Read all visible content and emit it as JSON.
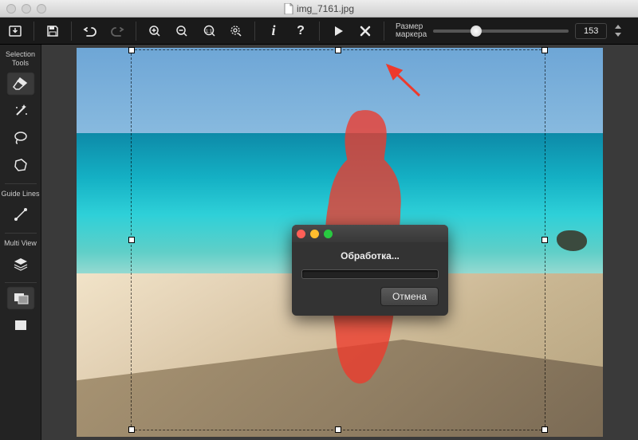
{
  "titlebar": {
    "filename": "img_7161.jpg"
  },
  "toolbar": {
    "marker_size_label": "Размер\nмаркера",
    "marker_size_value": "153",
    "marker_size_percent": 30
  },
  "sidebar": {
    "selection_tools_label": "Selection\nTools",
    "guide_lines_label": "Guide\nLines",
    "multi_view_label": "Multi\nView"
  },
  "modal": {
    "message": "Обработка...",
    "cancel_label": "Отмена"
  },
  "icons": {
    "export": "export-icon",
    "save": "save-icon",
    "undo": "undo-icon",
    "redo": "redo-icon",
    "zoom_in": "zoom-in-icon",
    "zoom_out": "zoom-out-icon",
    "zoom_100": "zoom-100-icon",
    "zoom_fit": "zoom-fit-icon",
    "info": "info-icon",
    "help": "help-icon",
    "play": "play-icon",
    "cancel_x": "cancel-icon",
    "eraser": "eraser-icon",
    "wand": "magic-wand-icon",
    "lasso": "lasso-icon",
    "poly": "polygon-lasso-icon",
    "line": "guide-line-icon",
    "layers": "layers-icon",
    "compare": "compare-icon",
    "single": "single-view-icon"
  },
  "colors": {
    "accent_red": "#ee3a2c",
    "mask_red": "rgba(238,58,44,0.78)"
  }
}
